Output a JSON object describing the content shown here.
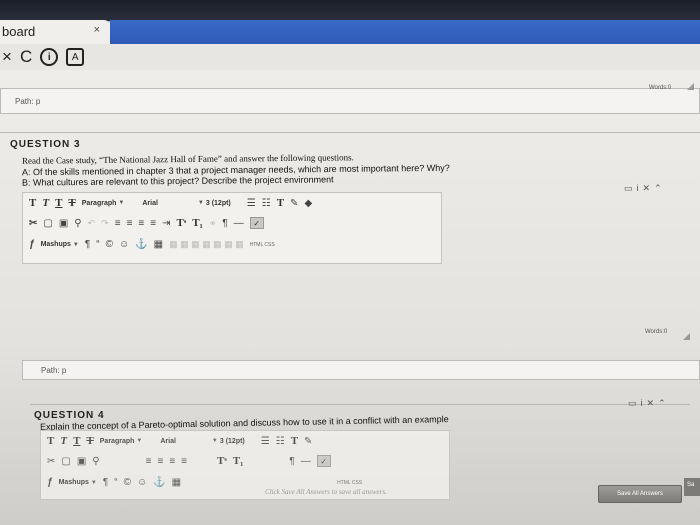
{
  "browser": {
    "tab_title": "board",
    "tab_close": "×",
    "nav_back": "×",
    "nav_reload": "C",
    "nav_info": "i",
    "nav_page": "A"
  },
  "editor_top": {
    "path": "Path: p",
    "words": "Words:0"
  },
  "question3": {
    "title": "QUESTION 3",
    "lines": [
      "Read the Case study, “The National Jazz Hall of Fame” and answer the following questions.",
      "A: Of the skills mentioned in chapter 3 that a project manager needs, which are most important here? Why?",
      "B: What cultures are relevant to this project? Describe the project environment"
    ],
    "toolbar": {
      "paragraph": "Paragraph",
      "font": "Arial",
      "size": "3 (12pt)",
      "mashups": "Mashups",
      "html": "HTML CSS"
    },
    "words": "Words:0",
    "path": "Path: p"
  },
  "question4": {
    "title": "QUESTION 4",
    "text": "Explain the concept of a Pareto-optimal solution and discuss how to use it in a conflict with an example",
    "toolbar": {
      "paragraph": "Paragraph",
      "font": "Arial",
      "size": "3 (12pt)",
      "mashups": "Mashups",
      "html": "HTML CSS"
    }
  },
  "footer": {
    "click_save": "Click Save All Answers to save all answers.",
    "save_all": "Save All Answers",
    "save_submit": "Sa"
  },
  "colors": {
    "accent_blue": "#2f5bb7",
    "button_gray": "#7d7b77"
  }
}
